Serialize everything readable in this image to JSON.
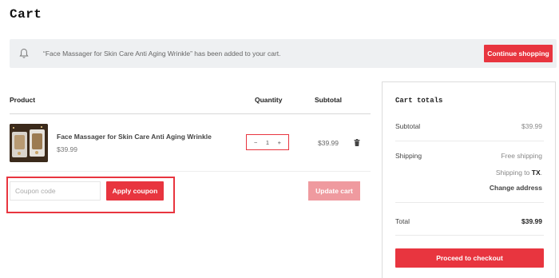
{
  "page": {
    "title": "Cart"
  },
  "notice": {
    "message": "“Face Massager for Skin Care Anti Aging Wrinkle” has been added to your cart.",
    "button_label": "Continue shopping",
    "icon": "bell-icon"
  },
  "table": {
    "headers": {
      "product": "Product",
      "quantity": "Quantity",
      "subtotal": "Subtotal"
    },
    "items": [
      {
        "name": "Face Massager for Skin Care Anti Aging Wrinkle",
        "price": "$39.99",
        "quantity": "1",
        "minus": "−",
        "plus": "+",
        "subtotal": "$39.99"
      }
    ]
  },
  "coupon": {
    "placeholder": "Coupon code",
    "apply_label": "Apply coupon"
  },
  "update_label": "Update cart",
  "totals": {
    "title": "Cart totals",
    "subtotal_label": "Subtotal",
    "subtotal_value": "$39.99",
    "shipping_label": "Shipping",
    "shipping_value": "Free shipping",
    "shipping_to_prefix": "Shipping to ",
    "shipping_to_state": "TX",
    "shipping_to_suffix": ".",
    "change_address": "Change address",
    "total_label": "Total",
    "total_value": "$39.99",
    "checkout_label": "Proceed to checkout"
  },
  "colors": {
    "accent": "#e8353f",
    "accent_disabled": "#ef9a9f",
    "notice_bg": "#eef0f2"
  }
}
